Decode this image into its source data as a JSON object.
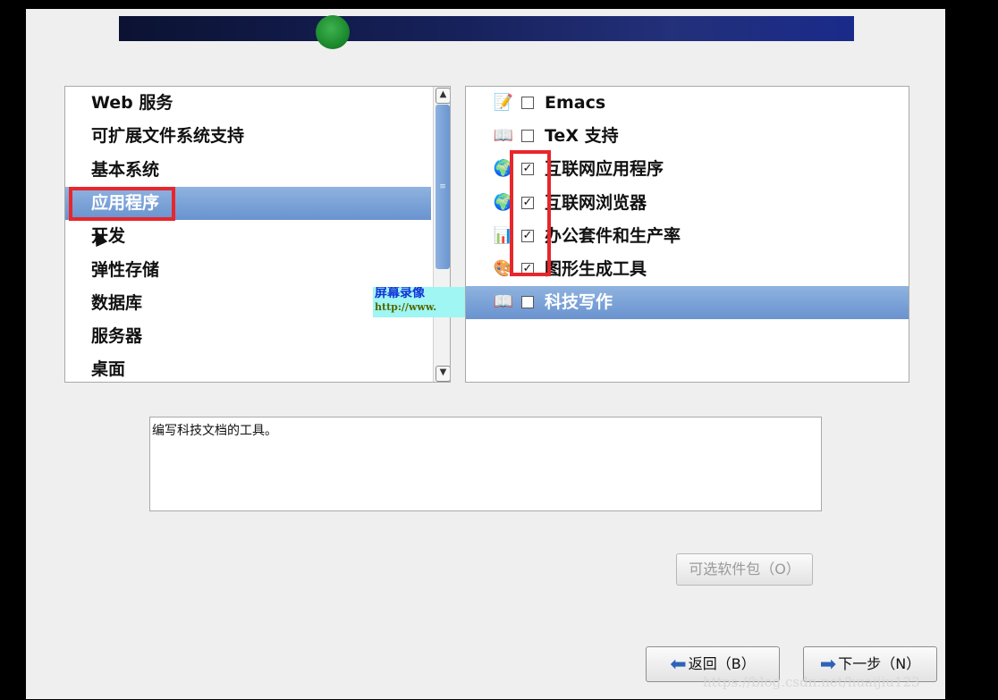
{
  "groups": [
    {
      "label": "Web 服务"
    },
    {
      "label": "可扩展文件系统支持"
    },
    {
      "label": "基本系统"
    },
    {
      "label": "应用程序",
      "selected": true
    },
    {
      "label": "开发"
    },
    {
      "label": "弹性存储"
    },
    {
      "label": "数据库"
    },
    {
      "label": "服务器"
    },
    {
      "label": "桌面"
    }
  ],
  "packages": [
    {
      "label": "Emacs",
      "checked": false,
      "icon": "editor-icon"
    },
    {
      "label": "TeX 支持",
      "checked": false,
      "icon": "book-icon"
    },
    {
      "label": "互联网应用程序",
      "checked": true,
      "icon": "globe-icon"
    },
    {
      "label": "互联网浏览器",
      "checked": true,
      "icon": "globe-icon"
    },
    {
      "label": "办公套件和生产率",
      "checked": true,
      "icon": "office-icon"
    },
    {
      "label": "图形生成工具",
      "checked": true,
      "icon": "graphics-icon"
    },
    {
      "label": "科技写作",
      "checked": false,
      "icon": "book-icon",
      "selected": true
    }
  ],
  "description": "编写科技文档的工具。",
  "buttons": {
    "optional": "可选软件包（O）",
    "back": "返回（B）",
    "next": "下一步（N）"
  },
  "watermark": {
    "badge_line1": "屏幕录像",
    "badge_line2": "http://www.",
    "url": "https://blog.csdn.net/huaijiu123"
  },
  "colors": {
    "selection": "#7aa0d6",
    "highlight": "#e8262b"
  }
}
